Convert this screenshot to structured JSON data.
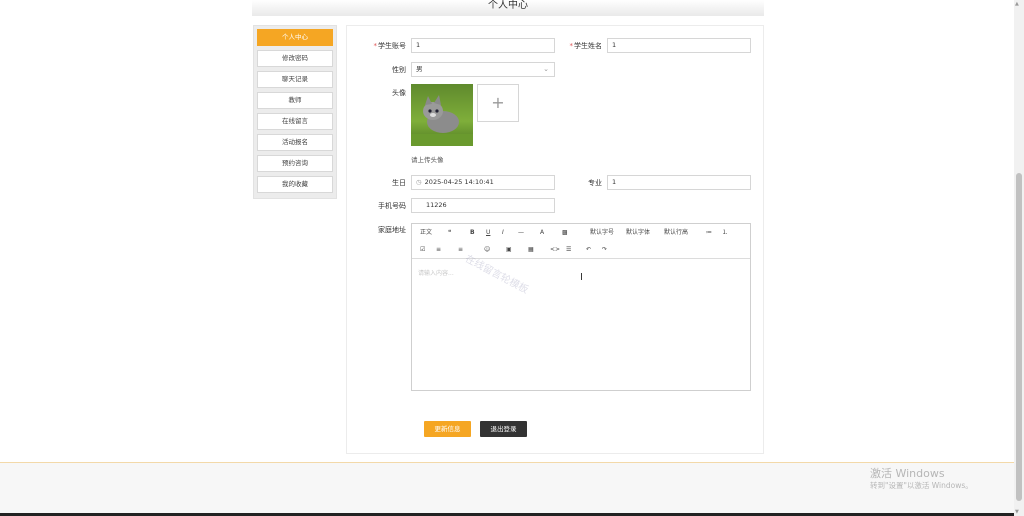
{
  "header": {
    "title": "个人中心"
  },
  "sidebar": {
    "items": [
      {
        "label": "个人中心"
      },
      {
        "label": "修改密码"
      },
      {
        "label": "聊天记录"
      },
      {
        "label": "教师"
      },
      {
        "label": "在线留言"
      },
      {
        "label": "活动报名"
      },
      {
        "label": "预约咨询"
      },
      {
        "label": "我的收藏"
      }
    ]
  },
  "form": {
    "student_no": {
      "label": "学生账号",
      "value": "1"
    },
    "student_name": {
      "label": "学生姓名",
      "value": "1"
    },
    "gender": {
      "label": "性别",
      "value": "男"
    },
    "avatar": {
      "label": "头像",
      "hint": "请上传头像"
    },
    "birthday": {
      "label": "生日",
      "value": "2025-04-25 14:10:41"
    },
    "major": {
      "label": "专业",
      "value": "1"
    },
    "phone": {
      "label": "手机号码",
      "value": "11226"
    },
    "address": {
      "label": "家庭地址",
      "placeholder": "请输入内容..."
    }
  },
  "editor": {
    "toolbar_row1": [
      "正文",
      "❝",
      "B",
      "U",
      "I",
      "—",
      "A",
      "▩",
      "默认字号",
      "默认字体",
      "默认行高",
      "≔",
      "⒈"
    ],
    "toolbar_row2": [
      "☑",
      "≡",
      "≡",
      "☺",
      "▣",
      "▦",
      "<>",
      "☰",
      "↶",
      "↷"
    ],
    "watermark": "在线留言轮模板"
  },
  "buttons": {
    "update": "更新信息",
    "logout": "退出登录"
  },
  "os_overlay": {
    "activate_title": "激活 Windows",
    "activate_sub": "转到\"设置\"以激活 Windows。"
  },
  "icons": {
    "add": "plus-icon",
    "clock": "clock-icon",
    "chevron": "chevron-down-icon"
  },
  "colors": {
    "accent": "#f5a623",
    "dark_button": "#333333"
  }
}
